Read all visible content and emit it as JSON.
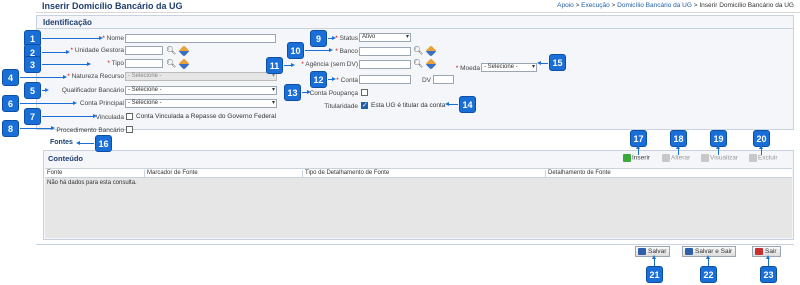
{
  "header": {
    "title": "Inserir Domicílio Bancário da UG",
    "breadcrumb": [
      "Apoio",
      "Execução",
      "Domicílio Bancário da UG",
      "Inserir Domicílio Bancário da UG"
    ],
    "separator": ">"
  },
  "identificacao": {
    "title": "Identificação",
    "nome": {
      "label": "Nome",
      "value": ""
    },
    "unidade_gestora": {
      "label": "Unidade Gestora",
      "value": ""
    },
    "tipo": {
      "label": "Tipo",
      "value": ""
    },
    "natureza_recurso": {
      "label": "Natureza Recurso",
      "value": "- Selecione -"
    },
    "qualificador_bancario": {
      "label": "Qualificador Bancário",
      "value": "- Selecione -"
    },
    "conta_principal": {
      "label": "Conta Principal",
      "value": "- Selecione -"
    },
    "vinculada": {
      "label": "Vinculada",
      "checkbox_text": "Conta Vinculada a Repasse do Governo Federal"
    },
    "procedimento_bancario": {
      "label": "Procedimento Bancário"
    },
    "status": {
      "label": "Status",
      "value": "Ativo"
    },
    "banco": {
      "label": "Banco",
      "value": ""
    },
    "agencia": {
      "label": "Agência (sem DV)",
      "value": ""
    },
    "conta": {
      "label": "Conta",
      "value": ""
    },
    "dv": {
      "label": "DV",
      "value": ""
    },
    "conta_poupanca": {
      "label": "Conta Poupança"
    },
    "titularidade": {
      "label": "Titularidade",
      "checkbox_text": "Esta UG é titular da conta",
      "checked": true
    },
    "moeda": {
      "label": "Moeda",
      "value": "- Selecione -"
    },
    "required_mark": "*"
  },
  "tabs": [
    {
      "label": "Fontes"
    }
  ],
  "conteudo": {
    "title": "Conteúdo",
    "actions": {
      "inserir": "Inserir",
      "alterar": "Alterar",
      "visualizar": "Visualizar",
      "excluir": "Excluir"
    },
    "columns": [
      "Fonte",
      "Marcador de Fonte",
      "Tipo de Detalhamento de Fonte",
      "Detalhamento de Fonte"
    ],
    "empty_text": "Não há dados para esta consulta."
  },
  "footer": {
    "salvar": "Salvar",
    "salvar_sair": "Salvar e Sair",
    "sair": "Sair"
  },
  "badges": [
    "1",
    "2",
    "3",
    "4",
    "5",
    "6",
    "7",
    "8",
    "9",
    "10",
    "11",
    "12",
    "13",
    "14",
    "15",
    "16",
    "17",
    "18",
    "19",
    "20",
    "21",
    "22",
    "23"
  ],
  "colors": {
    "accent": "#1a6fd6",
    "title": "#1f3f6e",
    "required": "#cc0000"
  }
}
